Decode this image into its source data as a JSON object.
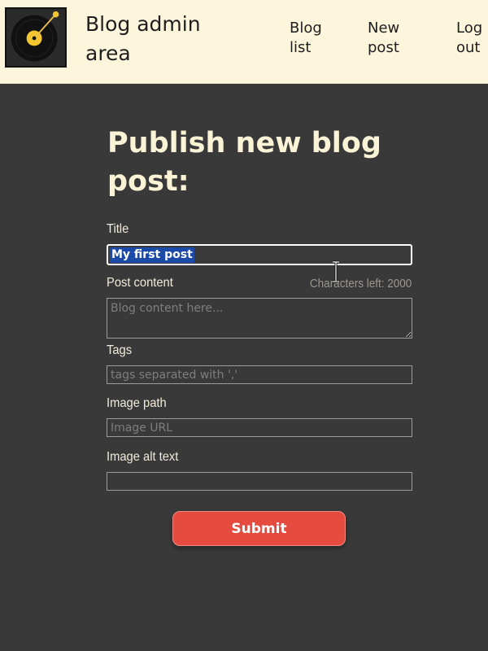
{
  "header": {
    "brand": "Blog admin area",
    "nav": {
      "blog_list": "Blog list",
      "new_post": "New post",
      "log_out": "Log out"
    }
  },
  "form": {
    "title": "Publish new blog post:",
    "chars_left": "Characters left: 2000",
    "fields": {
      "title": {
        "label": "Title",
        "value": "My first post"
      },
      "content": {
        "label": "Post content",
        "placeholder": "Blog content here..."
      },
      "tags": {
        "label": "Tags",
        "placeholder": "tags separated with ','"
      },
      "image": {
        "label": "Image path",
        "placeholder": "Image URL"
      },
      "alt": {
        "label": "Image alt text",
        "placeholder": ""
      }
    },
    "submit_label": "Submit"
  },
  "colors": {
    "background": "#393939",
    "header": "#fdf6dc",
    "accent": "#e54b3f",
    "heading": "#fbf3d6",
    "selection": "#1b4aa8"
  },
  "icons": {
    "logo": "vinyl-record-icon",
    "cursor": "text-cursor-icon"
  }
}
